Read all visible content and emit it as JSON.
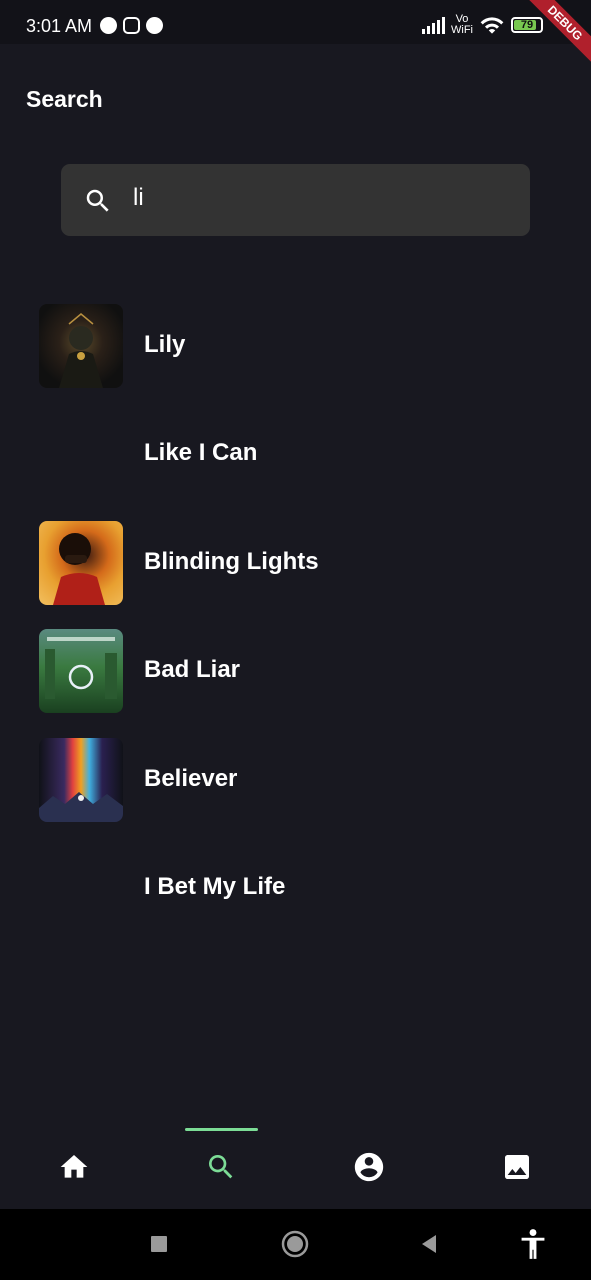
{
  "status_bar": {
    "time": "3:01 AM",
    "vowifi_line1": "Vo",
    "vowifi_line2": "WiFi",
    "battery": "79",
    "debug": "DEBUG"
  },
  "header": {
    "title": "Search"
  },
  "search": {
    "value": "li",
    "icon": "search-icon"
  },
  "results": [
    {
      "title": "Lily",
      "has_cover": true
    },
    {
      "title": "Like I Can",
      "has_cover": false
    },
    {
      "title": "Blinding Lights",
      "has_cover": true
    },
    {
      "title": "Bad Liar",
      "has_cover": true
    },
    {
      "title": "Believer",
      "has_cover": true
    },
    {
      "title": "I Bet My Life",
      "has_cover": false
    }
  ],
  "bottom_nav": {
    "items": [
      "home-icon",
      "search-icon",
      "account-icon",
      "image-icon"
    ],
    "active": "search-icon",
    "active_color": "#7cdc96"
  },
  "system_nav": [
    "recents-icon",
    "home-circle-icon",
    "back-icon",
    "accessibility-icon"
  ]
}
